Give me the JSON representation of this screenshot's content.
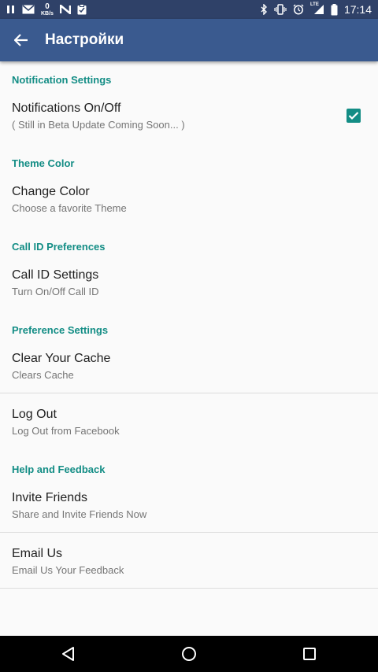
{
  "status_bar": {
    "kbs_value": "0",
    "kbs_unit": "KB/s",
    "time": "17:14",
    "lte_label": "LTE",
    "icons": [
      "pause-icon",
      "mail-icon",
      "network-speed-icon",
      "n-icon",
      "clipboard-icon",
      "bluetooth-icon",
      "vibrate-icon",
      "alarm-icon",
      "signal-icon",
      "battery-icon"
    ]
  },
  "toolbar": {
    "title": "Настройки",
    "back_icon": "arrow-back-icon",
    "color": "#3a5a8f"
  },
  "colors": {
    "accent": "#138d85",
    "status_bar": "#2f4168",
    "background": "#fafafa"
  },
  "sections": [
    {
      "category": "Notification Settings",
      "items": [
        {
          "title": "Notifications On/Off",
          "summary": "( Still in Beta Update Coming Soon... )",
          "checked": true
        }
      ]
    },
    {
      "category": "Theme Color",
      "items": [
        {
          "title": "Change Color",
          "summary": "Choose a favorite Theme"
        }
      ]
    },
    {
      "category": "Call ID Preferences",
      "items": [
        {
          "title": "Call ID Settings",
          "summary": "Turn On/Off Call ID"
        }
      ]
    },
    {
      "category": "Preference Settings",
      "items": [
        {
          "title": "Clear Your Cache",
          "summary": "Clears Cache"
        },
        {
          "title": "Log Out",
          "summary": "Log Out from Facebook"
        }
      ]
    },
    {
      "category": "Help and Feedback",
      "items": [
        {
          "title": "Invite Friends",
          "summary": "Share and Invite Friends Now"
        },
        {
          "title": "Email Us",
          "summary": "Email Us Your Feedback"
        }
      ]
    }
  ],
  "nav_bar": {
    "icons": [
      "back-triangle-icon",
      "home-circle-icon",
      "recents-square-icon"
    ]
  }
}
